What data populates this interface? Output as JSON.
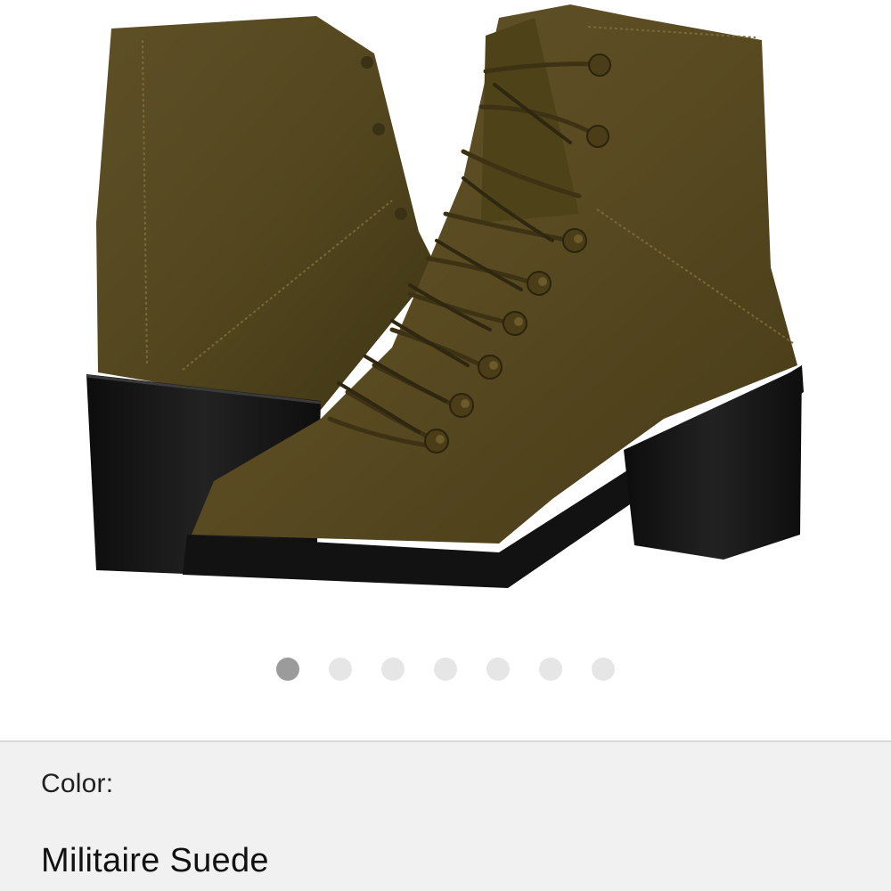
{
  "gallery": {
    "image_alt": "Lace-up suede block-heel ankle boots",
    "image_icon": "boot-product-image",
    "dots_total": 7,
    "active_index": 1
  },
  "color": {
    "label": "Color:",
    "value": "Militaire Suede"
  },
  "colors": {
    "suede": "#5a4a22",
    "heel": "#161616",
    "active_dot": "#9b9b9b",
    "inactive_dot": "#e6e6e6",
    "panel_bg": "#f1f1f1"
  }
}
